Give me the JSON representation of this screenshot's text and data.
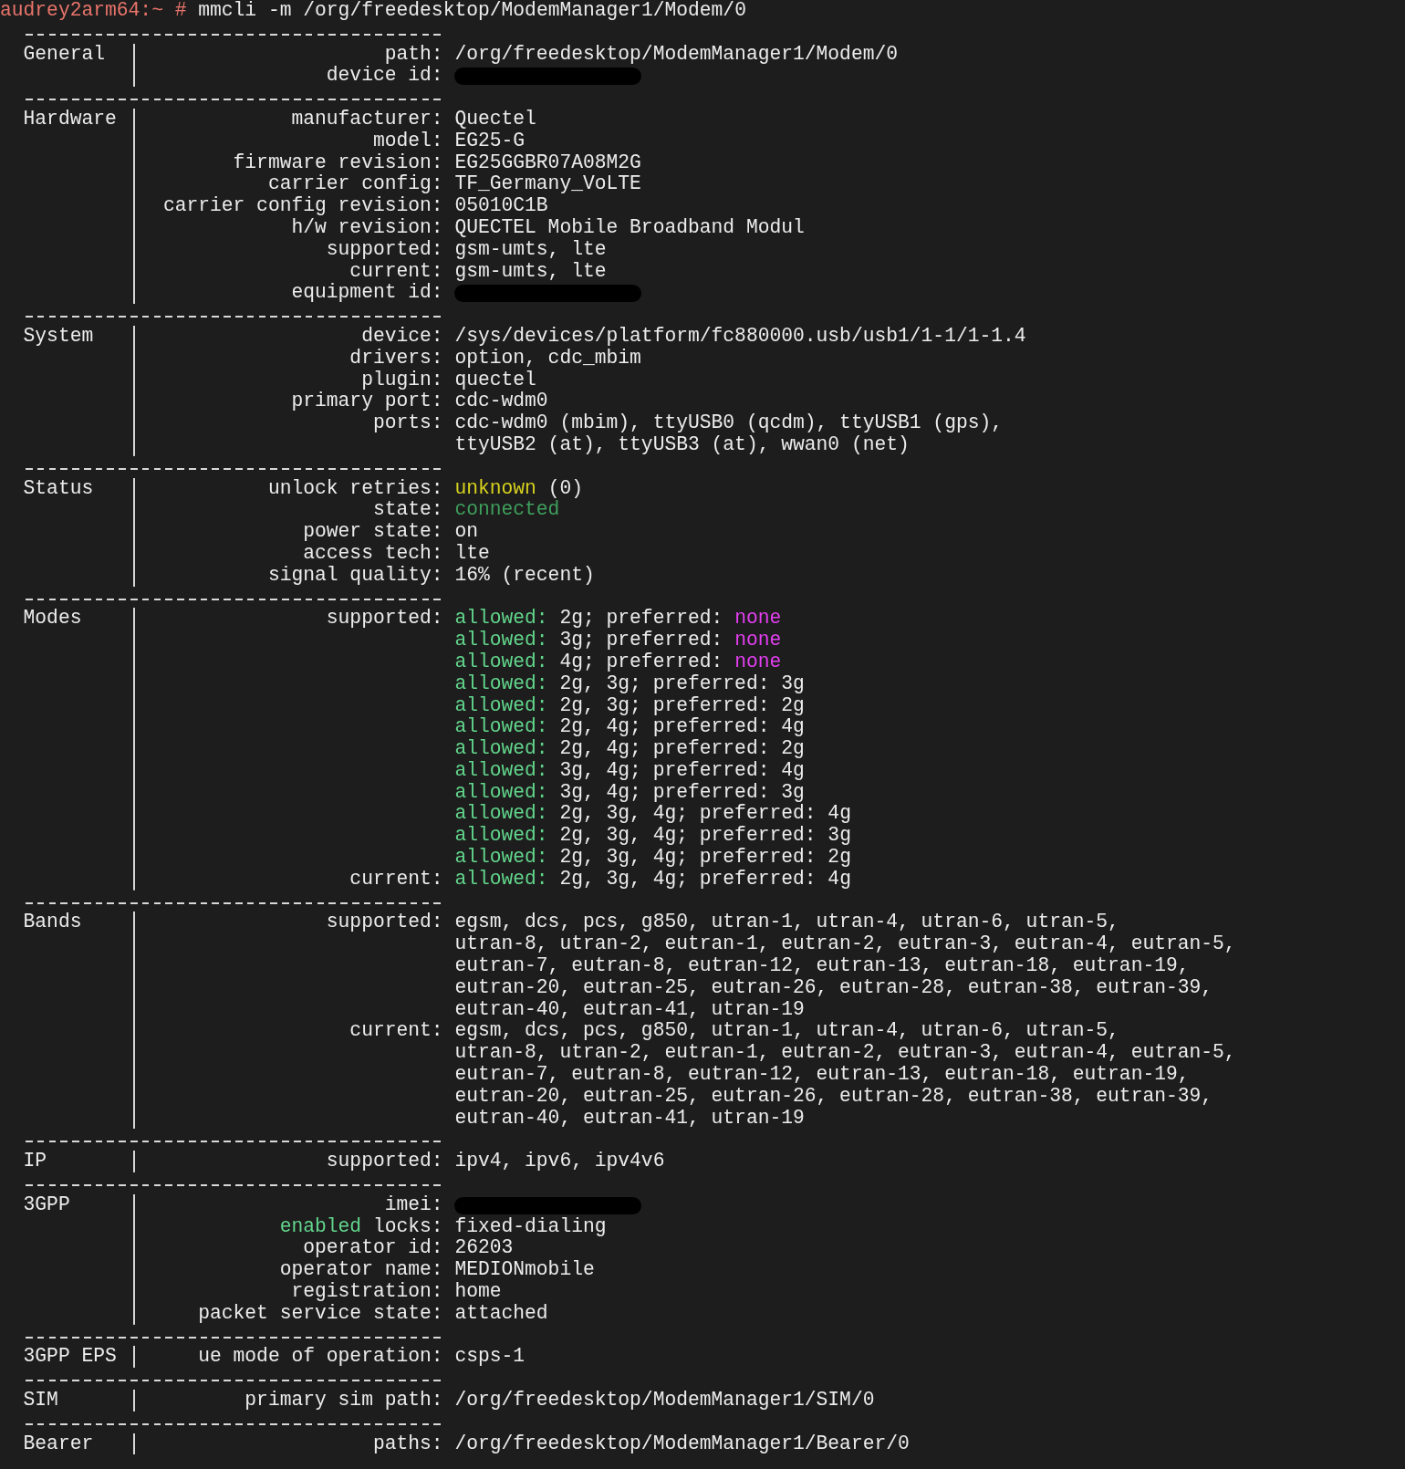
{
  "prompt": {
    "host": "audrey2arm64:~",
    "symbol": "#",
    "command": "mmcli -m /org/freedesktop/ModemManager1/Modem/0"
  },
  "sections": [
    {
      "name": "General",
      "fields": [
        {
          "key": "path:",
          "value": "/org/freedesktop/ModemManager1/Modem/0"
        },
        {
          "key": "device id:",
          "redacted": true
        }
      ]
    },
    {
      "name": "Hardware",
      "fields": [
        {
          "key": "manufacturer:",
          "value": "Quectel"
        },
        {
          "key": "model:",
          "value": "EG25-G"
        },
        {
          "key": "firmware revision:",
          "value": "EG25GGBR07A08M2G"
        },
        {
          "key": "carrier config:",
          "value": "TF_Germany_VoLTE"
        },
        {
          "key": "carrier config revision:",
          "value": "05010C1B"
        },
        {
          "key": "h/w revision:",
          "value": "QUECTEL Mobile Broadband Modul"
        },
        {
          "key": "supported:",
          "value": "gsm-umts, lte"
        },
        {
          "key": "current:",
          "value": "gsm-umts, lte"
        },
        {
          "key": "equipment id:",
          "redacted": true
        }
      ]
    },
    {
      "name": "System",
      "fields": [
        {
          "key": "device:",
          "value": "/sys/devices/platform/fc880000.usb/usb1/1-1/1-1.4"
        },
        {
          "key": "drivers:",
          "value": "option, cdc_mbim"
        },
        {
          "key": "plugin:",
          "value": "quectel"
        },
        {
          "key": "primary port:",
          "value": "cdc-wdm0"
        },
        {
          "key": "ports:",
          "value": "cdc-wdm0 (mbim), ttyUSB0 (qcdm), ttyUSB1 (gps),"
        },
        {
          "value": "ttyUSB2 (at), ttyUSB3 (at), wwan0 (net)"
        }
      ]
    },
    {
      "name": "Status",
      "fields": [
        {
          "key": "unlock retries:",
          "value": [
            {
              "text": "unknown",
              "color": "#d6d21e"
            },
            {
              "text": "(0)"
            }
          ]
        },
        {
          "key": "state:",
          "value": [
            {
              "text": "connected",
              "color": "#3f9f5c"
            }
          ]
        },
        {
          "key": "power state:",
          "value": "on"
        },
        {
          "key": "access tech:",
          "value": "lte"
        },
        {
          "key": "signal quality:",
          "value": "16% (recent)"
        }
      ]
    },
    {
      "name": "Modes",
      "fields": [
        {
          "key": "supported:",
          "value": [
            {
              "text": "allowed:",
              "color": "#62d68c"
            },
            {
              "text": "2g; preferred:"
            },
            {
              "text": "none",
              "color": "#e33ff0"
            }
          ]
        },
        {
          "value": [
            {
              "text": "allowed:",
              "color": "#62d68c"
            },
            {
              "text": "3g; preferred:"
            },
            {
              "text": "none",
              "color": "#e33ff0"
            }
          ]
        },
        {
          "value": [
            {
              "text": "allowed:",
              "color": "#62d68c"
            },
            {
              "text": "4g; preferred:"
            },
            {
              "text": "none",
              "color": "#e33ff0"
            }
          ]
        },
        {
          "value": [
            {
              "text": "allowed:",
              "color": "#62d68c"
            },
            {
              "text": "2g, 3g; preferred: 3g"
            }
          ]
        },
        {
          "value": [
            {
              "text": "allowed:",
              "color": "#62d68c"
            },
            {
              "text": "2g, 3g; preferred: 2g"
            }
          ]
        },
        {
          "value": [
            {
              "text": "allowed:",
              "color": "#62d68c"
            },
            {
              "text": "2g, 4g; preferred: 4g"
            }
          ]
        },
        {
          "value": [
            {
              "text": "allowed:",
              "color": "#62d68c"
            },
            {
              "text": "2g, 4g; preferred: 2g"
            }
          ]
        },
        {
          "value": [
            {
              "text": "allowed:",
              "color": "#62d68c"
            },
            {
              "text": "3g, 4g; preferred: 4g"
            }
          ]
        },
        {
          "value": [
            {
              "text": "allowed:",
              "color": "#62d68c"
            },
            {
              "text": "3g, 4g; preferred: 3g"
            }
          ]
        },
        {
          "value": [
            {
              "text": "allowed:",
              "color": "#62d68c"
            },
            {
              "text": "2g, 3g, 4g; preferred: 4g"
            }
          ]
        },
        {
          "value": [
            {
              "text": "allowed:",
              "color": "#62d68c"
            },
            {
              "text": "2g, 3g, 4g; preferred: 3g"
            }
          ]
        },
        {
          "value": [
            {
              "text": "allowed:",
              "color": "#62d68c"
            },
            {
              "text": "2g, 3g, 4g; preferred: 2g"
            }
          ]
        },
        {
          "key": "current:",
          "value": [
            {
              "text": "allowed:",
              "color": "#62d68c"
            },
            {
              "text": "2g, 3g, 4g; preferred: 4g"
            }
          ]
        }
      ]
    },
    {
      "name": "Bands",
      "fields": [
        {
          "key": "supported:",
          "value": "egsm, dcs, pcs, g850, utran-1, utran-4, utran-6, utran-5,"
        },
        {
          "value": "utran-8, utran-2, eutran-1, eutran-2, eutran-3, eutran-4, eutran-5,"
        },
        {
          "value": "eutran-7, eutran-8, eutran-12, eutran-13, eutran-18, eutran-19,"
        },
        {
          "value": "eutran-20, eutran-25, eutran-26, eutran-28, eutran-38, eutran-39,"
        },
        {
          "value": "eutran-40, eutran-41, utran-19"
        },
        {
          "key": "current:",
          "value": "egsm, dcs, pcs, g850, utran-1, utran-4, utran-6, utran-5,"
        },
        {
          "value": "utran-8, utran-2, eutran-1, eutran-2, eutran-3, eutran-4, eutran-5,"
        },
        {
          "value": "eutran-7, eutran-8, eutran-12, eutran-13, eutran-18, eutran-19,"
        },
        {
          "value": "eutran-20, eutran-25, eutran-26, eutran-28, eutran-38, eutran-39,"
        },
        {
          "value": "eutran-40, eutran-41, utran-19"
        }
      ]
    },
    {
      "name": "IP",
      "fields": [
        {
          "key": "supported:",
          "value": "ipv4, ipv6, ipv4v6"
        }
      ]
    },
    {
      "name": "3GPP",
      "fields": [
        {
          "key": "imei:",
          "redacted": true
        },
        {
          "key": [
            {
              "text": "enabled",
              "color": "#62d68c"
            },
            {
              "text": "locks:"
            }
          ],
          "value": "fixed-dialing"
        },
        {
          "key": "operator id:",
          "value": "26203"
        },
        {
          "key": "operator name:",
          "value": "MEDIONmobile"
        },
        {
          "key": "registration:",
          "value": "home"
        },
        {
          "key": "packet service state:",
          "value": "attached"
        }
      ]
    },
    {
      "name": "3GPP EPS",
      "fields": [
        {
          "key": "ue mode of operation:",
          "value": "csps-1"
        }
      ]
    },
    {
      "name": "SIM",
      "fields": [
        {
          "key": "primary sim path:",
          "value": "/org/freedesktop/ModemManager1/SIM/0"
        }
      ]
    },
    {
      "name": "Bearer",
      "fields": [
        {
          "key": "paths:",
          "value": "/org/freedesktop/ModemManager1/Bearer/0"
        }
      ]
    }
  ]
}
